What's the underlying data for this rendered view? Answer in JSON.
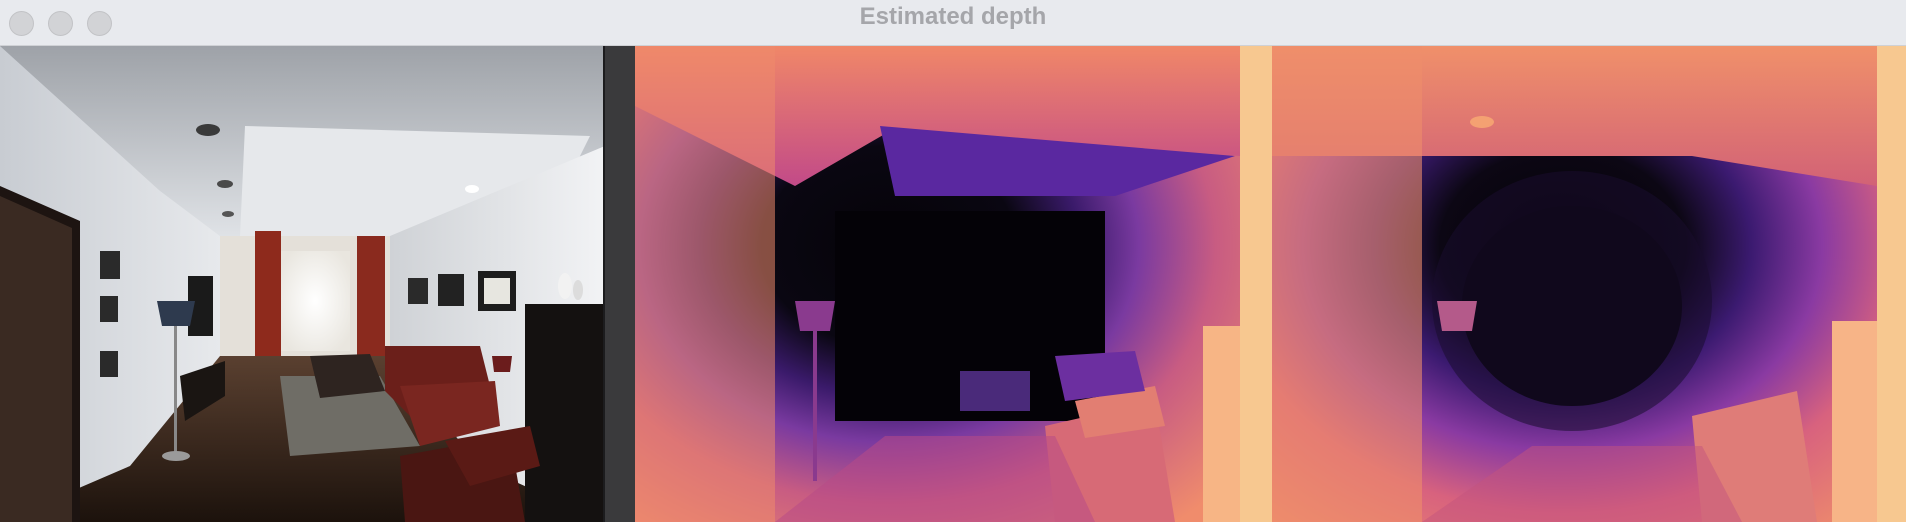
{
  "window": {
    "title": "Estimated depth"
  },
  "controls": {
    "close_label": "close",
    "minimize_label": "minimize",
    "zoom_label": "zoom"
  },
  "panels": [
    {
      "kind": "rgb-frame"
    },
    {
      "kind": "depth-map-ground-truth"
    },
    {
      "kind": "depth-map-estimated"
    }
  ],
  "colors": {
    "titlebar": "#e8eaee",
    "title_text": "#a5a6aa",
    "depth_near": "#f8c98c",
    "depth_mid": "#e77a6a",
    "depth_far_mid": "#6b2f9a",
    "depth_far": "#050308"
  }
}
